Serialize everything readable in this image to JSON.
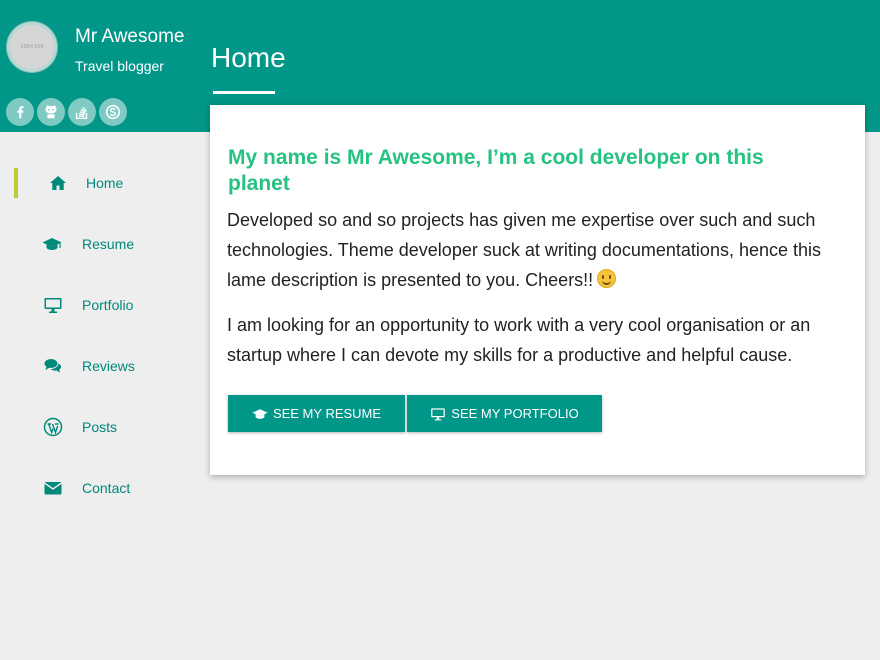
{
  "profile": {
    "avatar_text": "100×100",
    "name": "Mr Awesome",
    "role": "Travel blogger"
  },
  "socials": [
    {
      "icon": "facebook-icon"
    },
    {
      "icon": "github-icon"
    },
    {
      "icon": "stackoverflow-icon"
    },
    {
      "icon": "skype-icon"
    }
  ],
  "page": {
    "title": "Home"
  },
  "nav": {
    "items": [
      {
        "label": "Home",
        "icon": "home-icon",
        "active": true
      },
      {
        "label": "Resume",
        "icon": "graduation-cap-icon"
      },
      {
        "label": "Portfolio",
        "icon": "desktop-icon"
      },
      {
        "label": "Reviews",
        "icon": "comments-icon"
      },
      {
        "label": "Posts",
        "icon": "wordpress-icon"
      },
      {
        "label": "Contact",
        "icon": "envelope-icon"
      }
    ]
  },
  "card": {
    "heading": "My name is Mr Awesome, I’m a cool developer on this planet",
    "paragraph1": "Developed so and so projects has given me expertise over such and such technologies. Theme developer suck at writing documentations, hence this lame description is presented to you. Cheers!!",
    "paragraph2": "I am looking for an opportunity to work with a very cool organisation or an startup where I can devote my skills for a productive and helpful cause.",
    "resume_button": "See my resume",
    "portfolio_button": "See my portfolio"
  },
  "colors": {
    "primary": "#009688",
    "heading": "#26c281",
    "active_bar": "#c0ca33",
    "background": "#eeeeee"
  }
}
